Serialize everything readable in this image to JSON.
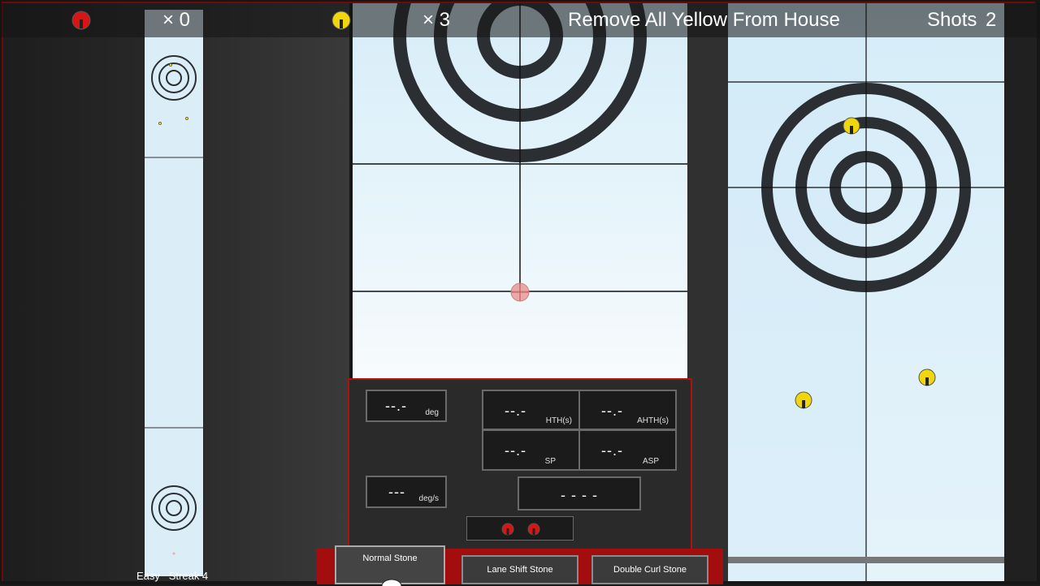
{
  "hud": {
    "red_count": "× 0",
    "yellow_count": "× 3",
    "objective": "Remove All Yellow From House",
    "shots_label": "Shots",
    "shots_value": "2"
  },
  "readouts": {
    "angle": {
      "value": "--.-",
      "unit": "deg"
    },
    "angular_velocity": {
      "value": "---",
      "unit": "deg/s"
    },
    "hth": {
      "value": "--.-",
      "unit": "HTH(s)"
    },
    "ahth": {
      "value": "--.-",
      "unit": "AHTH(s)"
    },
    "sp": {
      "value": "--.-",
      "unit": "SP"
    },
    "asp": {
      "value": "--.-",
      "unit": "ASP"
    },
    "status": {
      "value": "- - - -"
    }
  },
  "stone_types": [
    {
      "label": "Normal Stone",
      "selected": true
    },
    {
      "label": "Lane Shift Stone",
      "selected": false
    },
    {
      "label": "Double Curl Stone",
      "selected": false
    }
  ],
  "footer": {
    "difficulty": "Easy",
    "streak": "Streak 4"
  },
  "colors": {
    "red_stone": "#d81414",
    "yellow_stone": "#f2d60c",
    "ring": "#2b2f33",
    "panel_border": "#b01010"
  }
}
